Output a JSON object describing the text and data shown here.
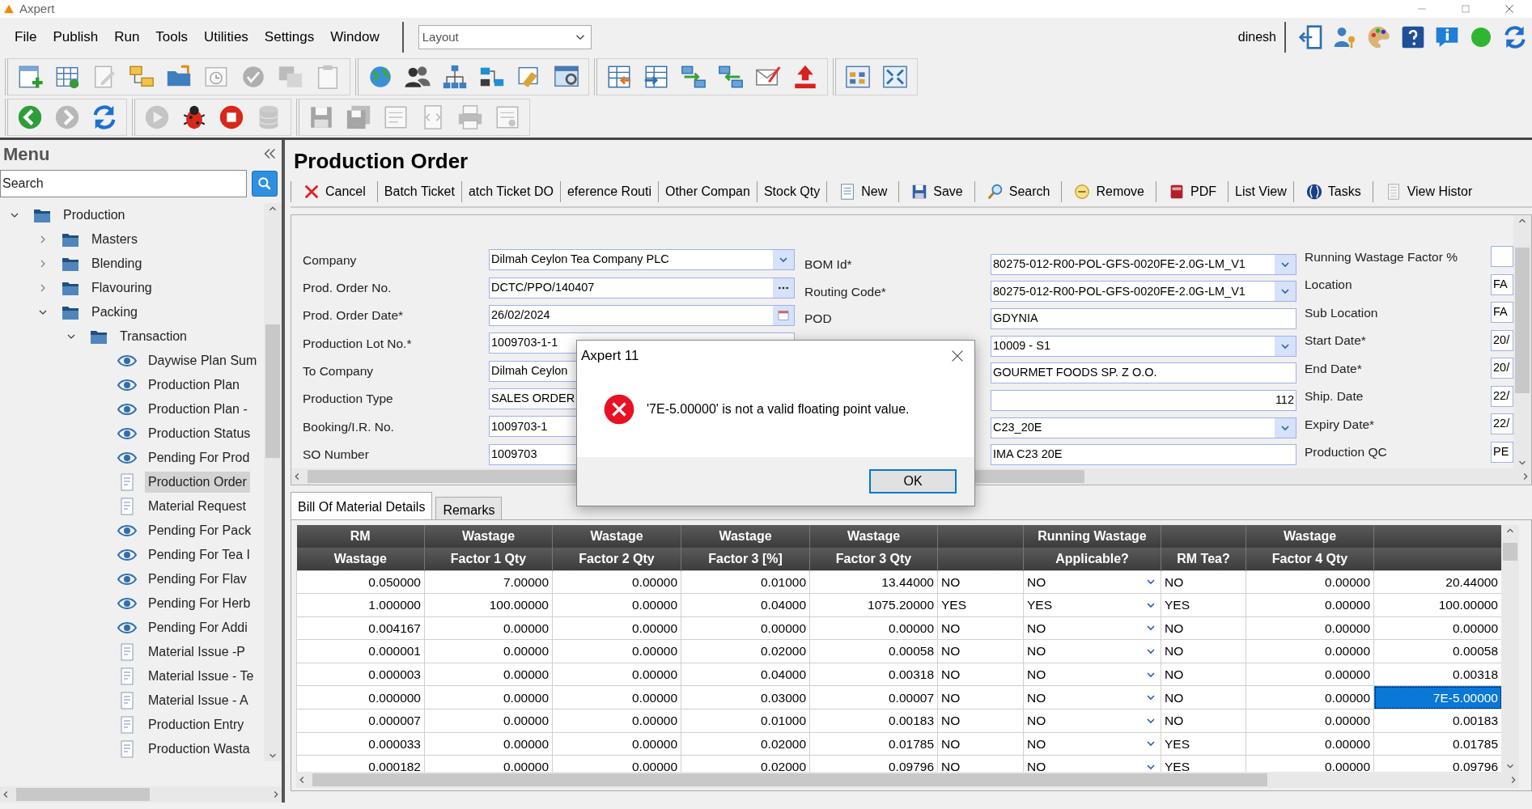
{
  "window": {
    "title": "Axpert"
  },
  "menu": [
    "File",
    "Publish",
    "Run",
    "Tools",
    "Utilities",
    "Settings",
    "Window"
  ],
  "layout_select": {
    "value": "Layout"
  },
  "user": "dinesh",
  "status_icons": [
    {
      "kind": "logout"
    },
    {
      "kind": "user-key"
    },
    {
      "kind": "palette"
    },
    {
      "kind": "help"
    },
    {
      "kind": "info"
    },
    {
      "kind": "status"
    },
    {
      "kind": "refresh"
    }
  ],
  "toolbars": [
    {
      "groups": [
        {
          "items": [
            {
              "kind": "new-form",
              "disabled": false
            },
            {
              "kind": "table",
              "disabled": false
            },
            {
              "kind": "edit",
              "disabled": true
            },
            {
              "kind": "tree",
              "disabled": false
            },
            {
              "kind": "folder-export",
              "disabled": false
            },
            {
              "kind": "calendar-clock",
              "disabled": true
            },
            {
              "kind": "badge",
              "disabled": true
            },
            {
              "kind": "translate",
              "disabled": true
            },
            {
              "kind": "clipboard",
              "disabled": true
            }
          ]
        },
        {
          "items": [
            {
              "kind": "globe",
              "disabled": false
            },
            {
              "kind": "people",
              "disabled": false
            },
            {
              "kind": "hierarchy",
              "disabled": false
            },
            {
              "kind": "connector",
              "disabled": false
            },
            {
              "kind": "handshake",
              "disabled": false
            },
            {
              "kind": "window-settings",
              "disabled": false
            }
          ]
        },
        {
          "items": [
            {
              "kind": "table-import",
              "disabled": false
            },
            {
              "kind": "table-export",
              "disabled": false
            },
            {
              "kind": "network-right",
              "disabled": false
            },
            {
              "kind": "network-left",
              "disabled": false
            },
            {
              "kind": "envelope",
              "disabled": false
            },
            {
              "kind": "upload",
              "disabled": false
            }
          ]
        },
        {
          "items": [
            {
              "kind": "tiles",
              "disabled": false
            },
            {
              "kind": "fullscreen",
              "disabled": false
            }
          ]
        }
      ]
    },
    {
      "groups": [
        {
          "items": [
            {
              "kind": "back",
              "disabled": false
            },
            {
              "kind": "forward",
              "disabled": true
            },
            {
              "kind": "refresh",
              "disabled": false
            }
          ]
        },
        {
          "items": [
            {
              "kind": "play",
              "disabled": true
            },
            {
              "kind": "bug",
              "disabled": false
            },
            {
              "kind": "stop",
              "disabled": false
            },
            {
              "kind": "database",
              "disabled": true
            }
          ]
        },
        {
          "items": [
            {
              "kind": "save",
              "disabled": true
            },
            {
              "kind": "save-all",
              "disabled": true
            },
            {
              "kind": "form",
              "disabled": true
            },
            {
              "kind": "code",
              "disabled": true
            },
            {
              "kind": "print",
              "disabled": true
            },
            {
              "kind": "report",
              "disabled": true
            }
          ]
        }
      ]
    }
  ],
  "sidebar": {
    "title": "Menu",
    "search": {
      "placeholder": "Search"
    },
    "tree": [
      {
        "label": "Production",
        "kind": "folder",
        "expanded": true,
        "selected": false,
        "children": [
          {
            "label": "Masters",
            "kind": "folder",
            "expanded": false,
            "selected": false
          },
          {
            "label": "Blending",
            "kind": "folder",
            "expanded": false,
            "selected": false
          },
          {
            "label": "Flavouring",
            "kind": "folder",
            "expanded": false,
            "selected": false
          },
          {
            "label": "Packing",
            "kind": "folder",
            "expanded": true,
            "selected": false,
            "children": [
              {
                "label": "Transaction",
                "kind": "folder",
                "expanded": true,
                "selected": false,
                "children": [
                  {
                    "label": "Daywise Plan Sum",
                    "kind": "report",
                    "selected": false
                  },
                  {
                    "label": "Production Plan",
                    "kind": "report",
                    "selected": false
                  },
                  {
                    "label": "Production Plan -",
                    "kind": "report",
                    "selected": false
                  },
                  {
                    "label": "Production Status",
                    "kind": "report",
                    "selected": false
                  },
                  {
                    "label": "Pending For Prod",
                    "kind": "report",
                    "selected": false
                  },
                  {
                    "label": "Production Order",
                    "kind": "form",
                    "selected": true
                  },
                  {
                    "label": "Material Request",
                    "kind": "form",
                    "selected": false
                  },
                  {
                    "label": "Pending For Pack",
                    "kind": "report",
                    "selected": false
                  },
                  {
                    "label": "Pending For Tea I",
                    "kind": "report",
                    "selected": false
                  },
                  {
                    "label": "Pending For Flav",
                    "kind": "report",
                    "selected": false
                  },
                  {
                    "label": "Pending For Herb",
                    "kind": "report",
                    "selected": false
                  },
                  {
                    "label": "Pending For Addi",
                    "kind": "report",
                    "selected": false
                  },
                  {
                    "label": "Material Issue -P",
                    "kind": "form",
                    "selected": false
                  },
                  {
                    "label": "Material Issue - Te",
                    "kind": "form",
                    "selected": false
                  },
                  {
                    "label": "Material Issue - A",
                    "kind": "form",
                    "selected": false
                  },
                  {
                    "label": "Production Entry",
                    "kind": "form",
                    "selected": false
                  },
                  {
                    "label": "Production Wasta",
                    "kind": "form",
                    "selected": false
                  }
                ]
              }
            ]
          }
        ]
      }
    ]
  },
  "page": {
    "title": "Production Order",
    "actions": [
      {
        "label": "Cancel",
        "kind": "cancel"
      },
      {
        "label": "Batch Ticket",
        "kind": "text"
      },
      {
        "label": "atch Ticket DO",
        "kind": "text"
      },
      {
        "label": "eference Routi",
        "kind": "text"
      },
      {
        "label": "Other Compan",
        "kind": "text"
      },
      {
        "label": "Stock Qty",
        "kind": "text"
      },
      {
        "label": "New",
        "kind": "new"
      },
      {
        "label": "Save",
        "kind": "save"
      },
      {
        "label": "Search",
        "kind": "search"
      },
      {
        "label": "Remove",
        "kind": "remove"
      },
      {
        "label": "PDF",
        "kind": "pdf"
      },
      {
        "label": "List View",
        "kind": "text"
      },
      {
        "label": "Tasks",
        "kind": "tasks"
      },
      {
        "label": "View Histor",
        "kind": "history"
      }
    ],
    "form": {
      "columns": [
        {
          "fields": [
            {
              "label": "Company",
              "value": "Dilmah Ceylon Tea Company PLC",
              "kind": "dropdown"
            },
            {
              "label": "Prod. Order No.",
              "value": "DCTC/PPO/140407",
              "kind": "lookup"
            },
            {
              "label": "Prod. Order Date*",
              "value": "26/02/2024",
              "kind": "date"
            },
            {
              "label": "Production Lot No.*",
              "value": "1009703-1-1",
              "kind": "text"
            },
            {
              "label": "To Company",
              "value": "Dilmah Ceylon",
              "kind": "text"
            },
            {
              "label": "Production Type",
              "value": "SALES ORDER",
              "kind": "text"
            },
            {
              "label": "Booking/I.R. No.",
              "value": "1009703-1",
              "kind": "text"
            },
            {
              "label": "SO Number",
              "value": "1009703",
              "kind": "text"
            }
          ]
        },
        {
          "fields": [
            {
              "label": "BOM Id*",
              "value": "80275-012-R00-POL-GFS-0020FE-2.0G-LM_V1",
              "kind": "dropdown"
            },
            {
              "label": "Routing Code*",
              "value": "80275-012-R00-POL-GFS-0020FE-2.0G-LM_V1",
              "kind": "dropdown"
            },
            {
              "label": "POD",
              "value": "GDYNIA",
              "kind": "text"
            },
            {
              "value": "10009 - S1",
              "kind": "dropdown"
            },
            {
              "value": "GOURMET FOODS SP. Z O.O.",
              "kind": "text"
            },
            {
              "value": "112",
              "kind": "number"
            },
            {
              "value": "C23_20E",
              "kind": "dropdown"
            },
            {
              "value": "IMA C23 20E",
              "kind": "text"
            }
          ]
        },
        {
          "fields": [
            {
              "label": "Running Wastage Factor %",
              "kind": "text"
            },
            {
              "label": "Location",
              "value": "FA",
              "kind": "text"
            },
            {
              "label": "Sub Location",
              "value": "FA",
              "kind": "text"
            },
            {
              "label": "Start Date*",
              "value": "20/",
              "kind": "text"
            },
            {
              "label": "End Date*",
              "value": "20/",
              "kind": "text"
            },
            {
              "label": "Ship. Date",
              "value": "22/",
              "kind": "text"
            },
            {
              "label": "Expiry Date*",
              "value": "22/",
              "kind": "text"
            },
            {
              "label": "Production QC",
              "value": "PE",
              "kind": "text"
            }
          ]
        }
      ]
    },
    "tabs": [
      {
        "label": "Bill Of Material Details",
        "selected": true
      },
      {
        "label": "Remarks",
        "selected": false
      }
    ],
    "table": {
      "columns": [
        {
          "lines": [
            "RM",
            "Wastage"
          ],
          "kind": "number"
        },
        {
          "lines": [
            "Wastage",
            "Factor 1 Qty"
          ],
          "kind": "number"
        },
        {
          "lines": [
            "Wastage",
            "Factor 2 Qty"
          ],
          "kind": "number"
        },
        {
          "lines": [
            "Wastage",
            "Factor 3 [%]"
          ],
          "kind": "number"
        },
        {
          "lines": [
            "Wastage",
            "Factor 3 Qty"
          ],
          "kind": "number"
        },
        {
          "kind": "text"
        },
        {
          "lines": [
            "Running Wastage",
            "Applicable?"
          ],
          "kind": "dropdown"
        },
        {
          "lines": [
            "RM Tea?"
          ],
          "kind": "text"
        },
        {
          "lines": [
            "Wastage",
            "Factor 4 Qty"
          ],
          "kind": "number"
        },
        {
          "kind": "number"
        }
      ],
      "rows": [
        {
          "cells": [
            "0.050000",
            "7.00000",
            "0.00000",
            "0.01000",
            "13.44000",
            "NO",
            "NO",
            "NO",
            "0.00000",
            "20.44000"
          ],
          "selected": false
        },
        {
          "cells": [
            "1.000000",
            "100.00000",
            "0.00000",
            "0.04000",
            "1075.20000",
            "YES",
            "YES",
            "YES",
            "0.00000",
            "100.00000"
          ],
          "selected": false
        },
        {
          "cells": [
            "0.004167",
            "0.00000",
            "0.00000",
            "0.00000",
            "0.00000",
            "NO",
            "NO",
            "NO",
            "0.00000",
            "0.00000"
          ],
          "selected": false
        },
        {
          "cells": [
            "0.000001",
            "0.00000",
            "0.00000",
            "0.02000",
            "0.00058",
            "NO",
            "NO",
            "NO",
            "0.00000",
            "0.00058"
          ],
          "selected": false
        },
        {
          "cells": [
            "0.000003",
            "0.00000",
            "0.00000",
            "0.04000",
            "0.00318",
            "NO",
            "NO",
            "NO",
            "0.00000",
            "0.00318"
          ],
          "selected": false
        },
        {
          "cells": [
            "0.000000",
            "0.00000",
            "0.00000",
            "0.03000",
            "0.00007",
            "NO",
            "NO",
            "NO",
            "0.00000",
            "7E-5.00000"
          ],
          "selected": true
        },
        {
          "cells": [
            "0.000007",
            "0.00000",
            "0.00000",
            "0.01000",
            "0.00183",
            "NO",
            "NO",
            "NO",
            "0.00000",
            "0.00183"
          ],
          "selected": false
        },
        {
          "cells": [
            "0.000033",
            "0.00000",
            "0.00000",
            "0.02000",
            "0.01785",
            "NO",
            "NO",
            "YES",
            "0.00000",
            "0.01785"
          ],
          "selected": false
        },
        {
          "cells": [
            "0.000182",
            "0.00000",
            "0.00000",
            "0.02000",
            "0.09796",
            "NO",
            "NO",
            "YES",
            "0.00000",
            "0.09796"
          ],
          "selected": false
        }
      ]
    }
  },
  "dialog": {
    "title": "Axpert 11",
    "kind": "error",
    "message": "'7E-5.00000' is not a valid floating point value.",
    "buttons": [
      {
        "label": "OK",
        "focused": true
      }
    ]
  }
}
